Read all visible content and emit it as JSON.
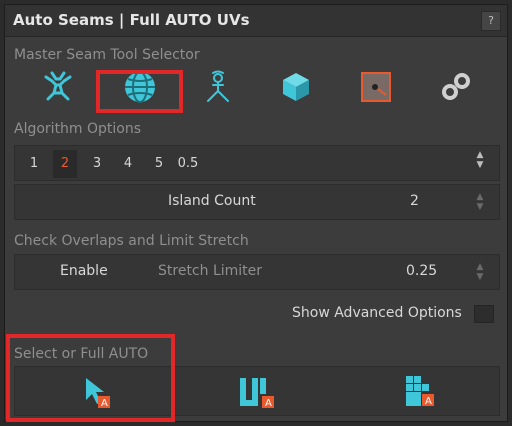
{
  "panel": {
    "title": "Auto Seams | Full AUTO UVs",
    "help_label": "?"
  },
  "master": {
    "label": "Master Seam Tool Selector",
    "tools": [
      {
        "icon": "body-figure-icon",
        "selected": false
      },
      {
        "icon": "sphere-grid-icon",
        "selected": true
      },
      {
        "icon": "character-seam-icon",
        "selected": false
      },
      {
        "icon": "cube-icon",
        "selected": false
      },
      {
        "icon": "texture-square-icon",
        "selected": false
      },
      {
        "icon": "link-chain-icon",
        "selected": false
      }
    ]
  },
  "algorithm": {
    "label": "Algorithm Options",
    "tabs": [
      "1",
      "2",
      "3",
      "4",
      "5",
      "0.5"
    ],
    "active_tab": "2",
    "island_count_label": "Island Count",
    "island_count_value": "2"
  },
  "overlaps": {
    "label": "Check Overlaps and Limit Stretch",
    "enable_label": "Enable",
    "stretch_label": "Stretch Limiter",
    "stretch_value": "0.25"
  },
  "advanced": {
    "label": "Show Advanced Options"
  },
  "auto": {
    "label": "Select or Full AUTO",
    "buttons": [
      {
        "icon": "cursor-auto-icon"
      },
      {
        "icon": "uv-auto-icon"
      },
      {
        "icon": "grid-blocks-auto-icon"
      }
    ]
  },
  "colors": {
    "accent_cyan": "#3fc6d9",
    "accent_orange": "#e85a2e",
    "highlight_red": "#e02828",
    "panel_bg": "#3c3c3c"
  }
}
